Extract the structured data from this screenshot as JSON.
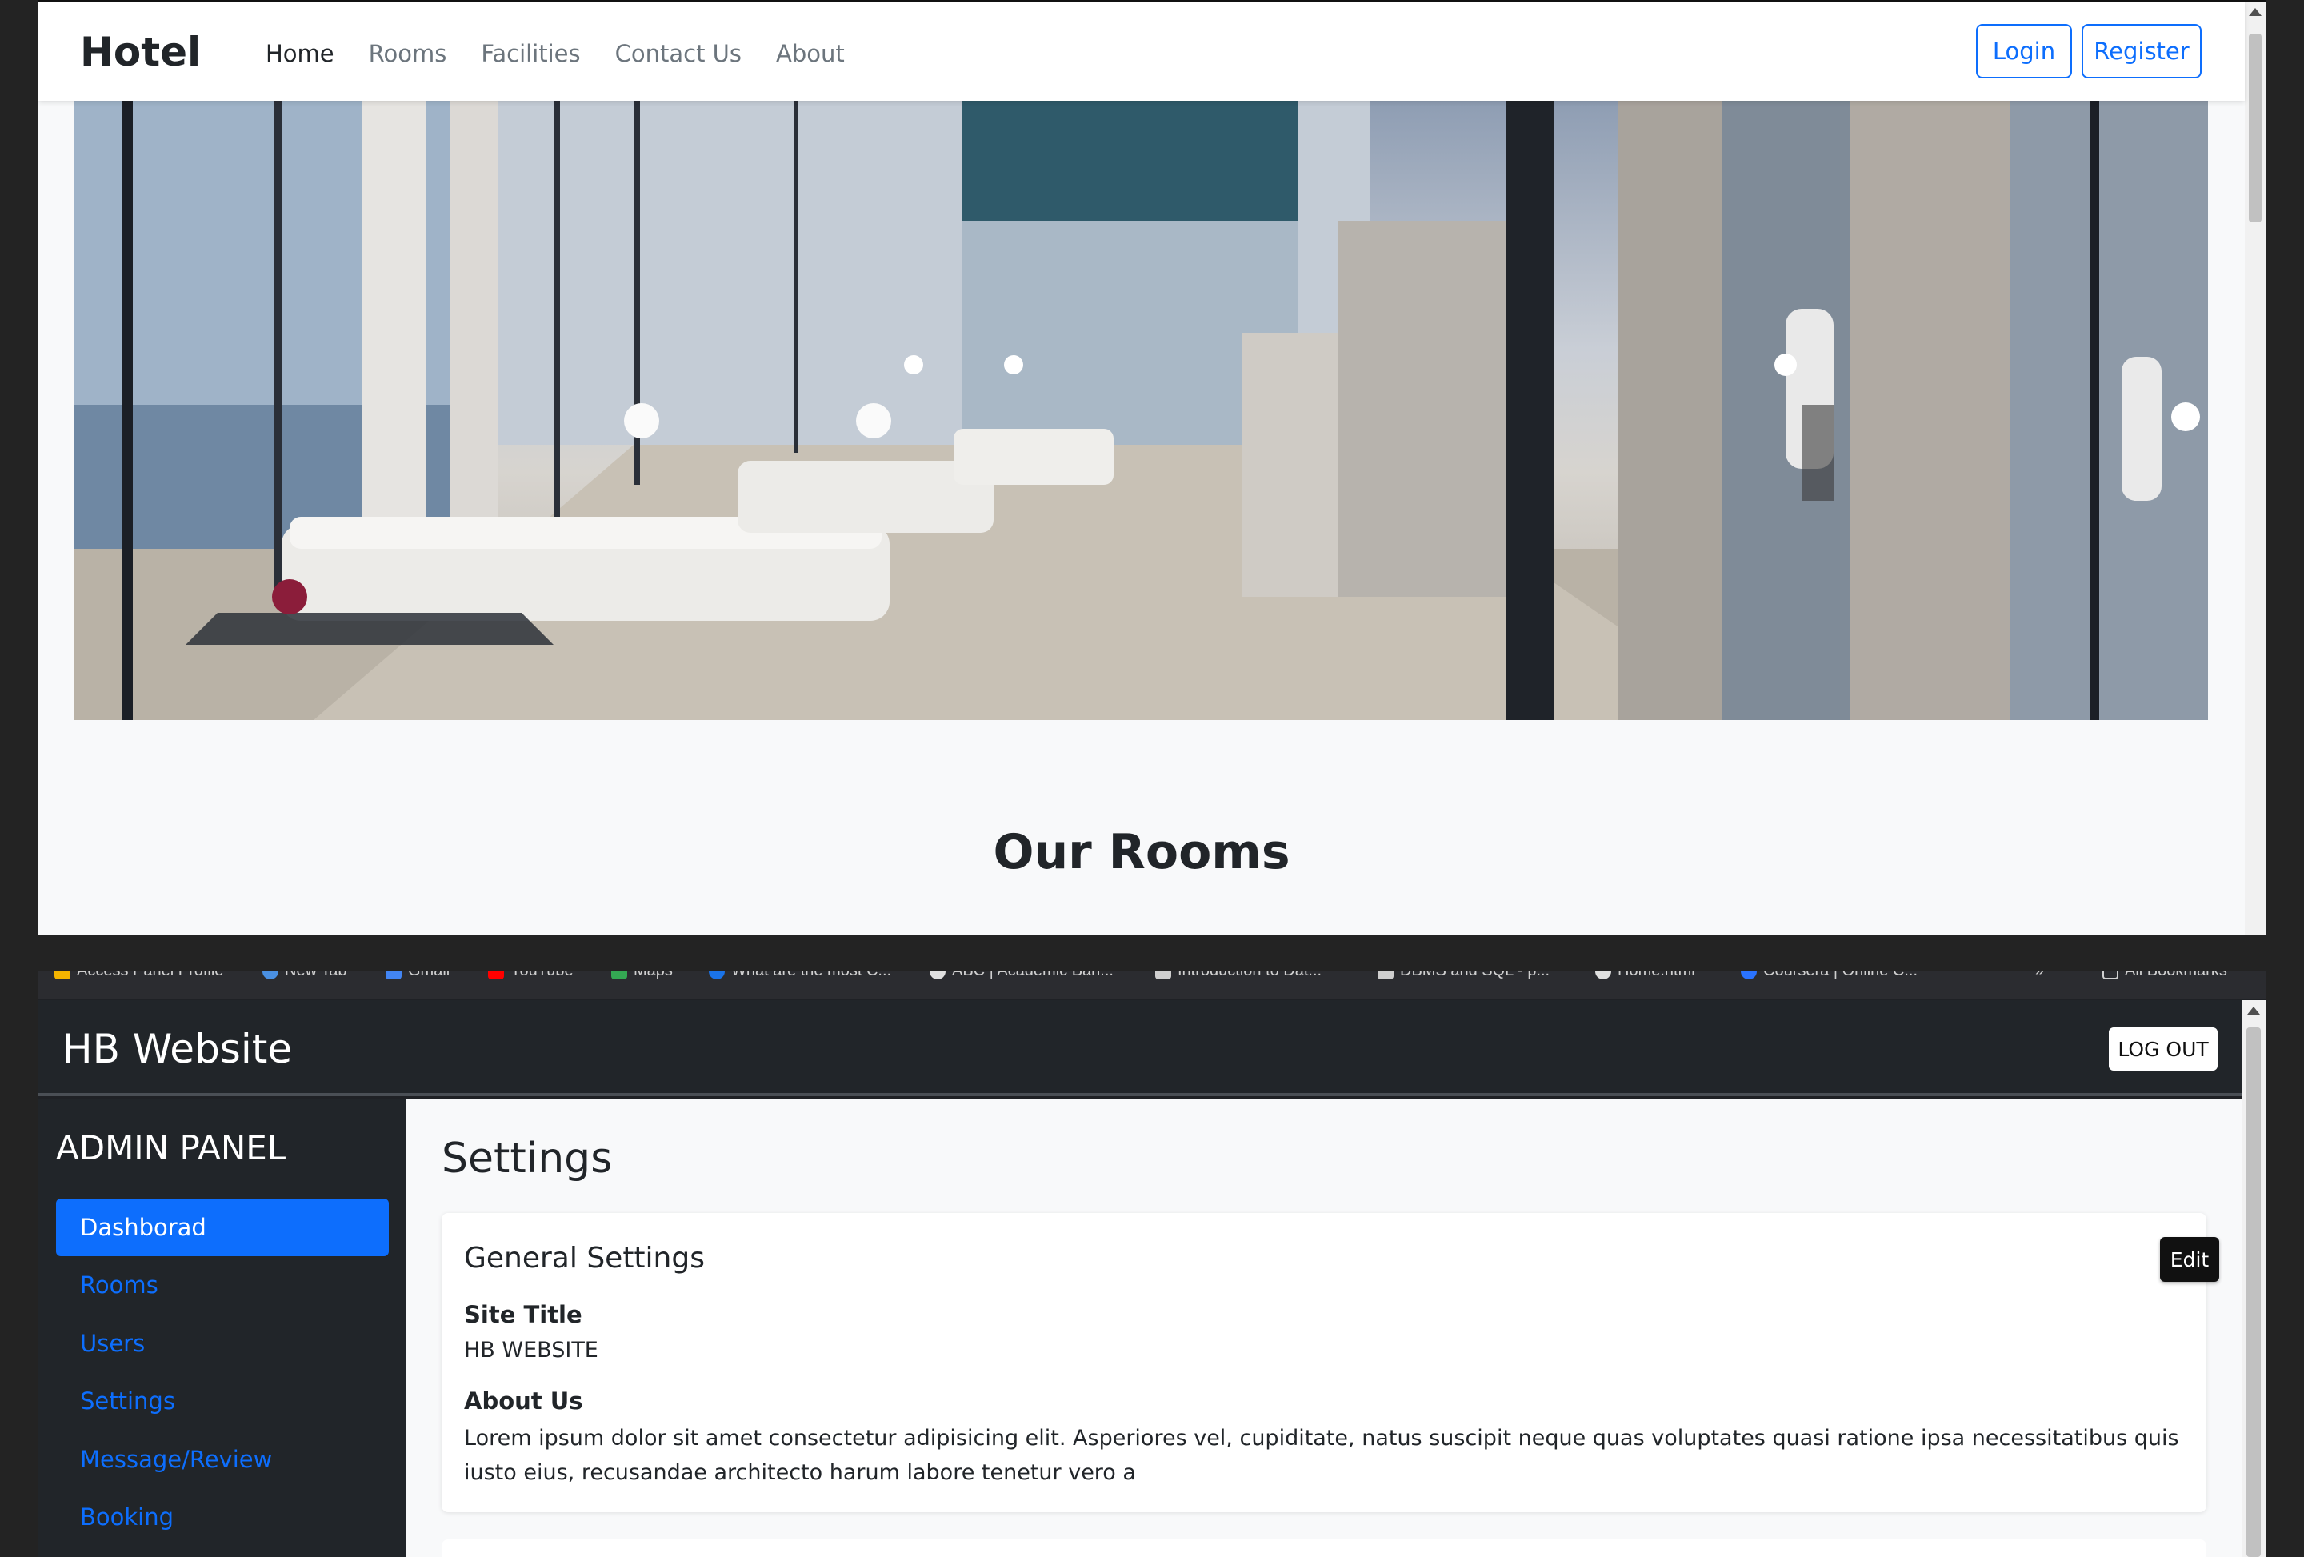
{
  "top": {
    "brand": "Hotel",
    "nav": [
      "Home",
      "Rooms",
      "Facilities",
      "Contact Us",
      "About"
    ],
    "login_label": "Login",
    "register_label": "Register",
    "section_title": "Our Rooms",
    "accent": "#0d6efd"
  },
  "bookmarks": [
    "Access Panel Profile",
    "New Tab",
    "Gmail",
    "YouTube",
    "Maps",
    "What are the most C...",
    "ABC | Academic Ban...",
    "Introduction to Dat...",
    "DBMS and SQL - p...",
    "Home.html",
    "Coursera | Online C...",
    "»",
    "All Bookmarks"
  ],
  "admin": {
    "brand": "HB Website",
    "logout_label": "LOG OUT",
    "panel_title": "ADMIN PANEL",
    "sidebar": [
      "Dashborad",
      "Rooms",
      "Users",
      "Settings",
      "Message/Review",
      "Booking"
    ],
    "page_title": "Settings",
    "card_title": "General Settings",
    "edit_label": "Edit",
    "site_title_label": "Site Title",
    "site_title_value": "HB WEBSITE",
    "about_label": "About Us",
    "about_value": "Lorem ipsum dolor sit amet consectetur adipisicing elit. Asperiores vel, cupiditate, natus suscipit neque quas voluptates quasi ratione ipsa necessitatibus quis iusto eius, recusandae architecto harum labore tenetur vero a"
  }
}
